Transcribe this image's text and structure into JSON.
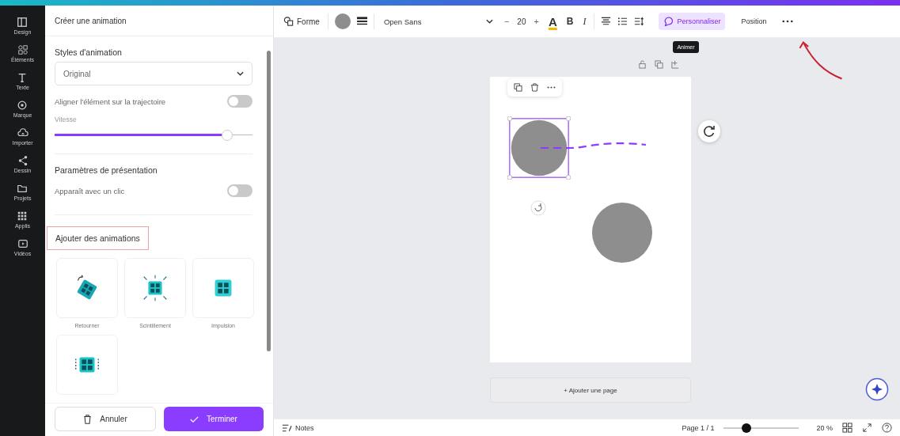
{
  "nav": [
    {
      "label": "Design",
      "kind": "layout"
    },
    {
      "label": "Éléments",
      "kind": "shapes"
    },
    {
      "label": "Texte",
      "kind": "text"
    },
    {
      "label": "Marque",
      "kind": "brand"
    },
    {
      "label": "Importer",
      "kind": "upload"
    },
    {
      "label": "Dessin",
      "kind": "draw"
    },
    {
      "label": "Projets",
      "kind": "folder"
    },
    {
      "label": "Applis",
      "kind": "grid"
    },
    {
      "label": "Vidéos",
      "kind": "video"
    }
  ],
  "panel": {
    "title": "Créer une animation",
    "style_heading": "Styles d'animation",
    "style_value": "Original",
    "align_label": "Aligner l'élément sur la trajectoire",
    "align_on": false,
    "speed": {
      "label": "Vitesse",
      "level": 0.87
    },
    "presentation_heading": "Paramètres de présentation",
    "click_label": "Apparaît avec un clic",
    "click_on": false,
    "add_heading": "Ajouter des animations",
    "animations": [
      {
        "label": "Retourner",
        "kind": "rotate"
      },
      {
        "label": "Scintillement",
        "kind": "sparkle"
      },
      {
        "label": "Impulsion",
        "kind": "pulse"
      },
      {
        "kind": "slide"
      }
    ],
    "cancel": "Annuler",
    "finish": "Terminer"
  },
  "toolbar": {
    "shape": "Forme",
    "font": "Open Sans",
    "minus": "−",
    "size": "20",
    "plus": "+",
    "color_letter": "A",
    "bold": "B",
    "italic": "I",
    "customize": "Personnaliser",
    "position": "Position",
    "tooltip": "Animer"
  },
  "canvas": {
    "add_page": "+ Ajouter une page"
  },
  "footer": {
    "notes": "Notes",
    "page": "Page 1 / 1",
    "zoom_slider": {
      "level": 0.3
    },
    "zoom": "20 %"
  }
}
